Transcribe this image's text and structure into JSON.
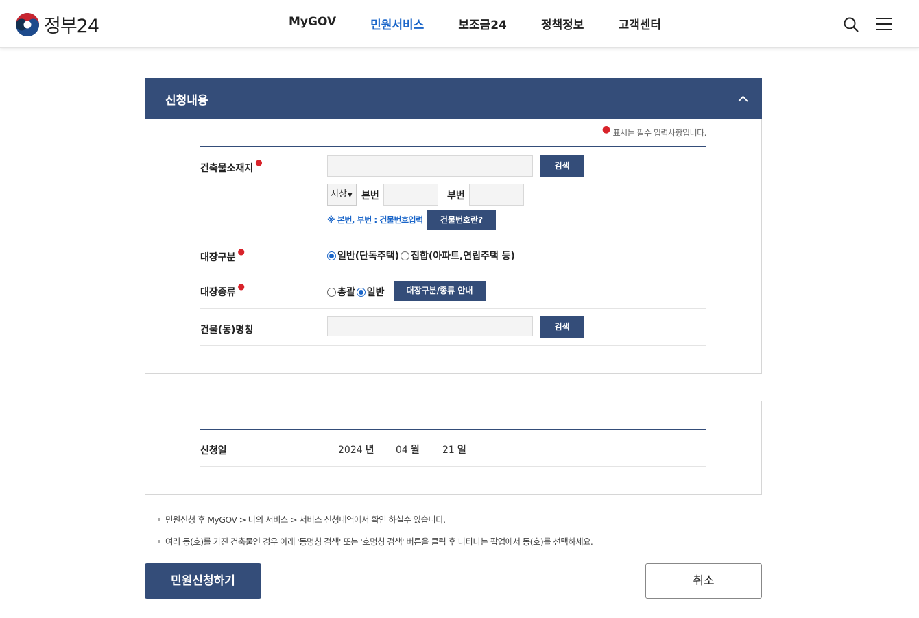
{
  "header": {
    "logo_text": "정부24",
    "nav": [
      {
        "label": "MyGOV",
        "active": false
      },
      {
        "label": "민원서비스",
        "active": true
      },
      {
        "label": "보조금24",
        "active": false
      },
      {
        "label": "정책정보",
        "active": false
      },
      {
        "label": "고객센터",
        "active": false
      }
    ]
  },
  "section": {
    "title": "신청내용",
    "required_note": "표시는 필수 입력사항입니다.",
    "location": {
      "label": "건축물소재지",
      "address_value": "",
      "search_label": "검색",
      "ground_select": "지상",
      "main_no_label": "본번",
      "sub_no_label": "부번",
      "main_no_value": "",
      "sub_no_value": "",
      "hint": "※ 본번, 부번 : 건물번호입력",
      "what_is_label": "건물번호란?"
    },
    "ledger_class": {
      "label": "대장구분",
      "options": [
        "일반(단독주택)",
        "집합(아파트,연립주택 등)"
      ],
      "selected": "일반(단독주택)"
    },
    "ledger_type": {
      "label": "대장종류",
      "options": [
        "총괄",
        "일반"
      ],
      "selected": "일반",
      "guide_label": "대장구분/종류 안내"
    },
    "building_name": {
      "label": "건물(동)명칭",
      "value": "",
      "search_label": "검색"
    }
  },
  "date_section": {
    "label": "신청일",
    "year": "2024",
    "year_unit": "년",
    "month": "04",
    "month_unit": "월",
    "day": "21",
    "day_unit": "일"
  },
  "notes": [
    "민원신청 후 MyGOV > 나의 서비스 > 서비스 신청내역에서 확인 하실수 있습니다.",
    "여러 동(호)를 가진 건축물인 경우 아래 '동명칭 검색' 또는 '호명칭 검색' 버튼을 클릭 후 나타나는 팝업에서 동(호)를 선택하세요."
  ],
  "actions": {
    "apply_label": "민원신청하기",
    "cancel_label": "취소"
  },
  "colors": {
    "navy": "#344d79",
    "link_blue": "#1b66c9",
    "required_red": "#d8232a"
  }
}
